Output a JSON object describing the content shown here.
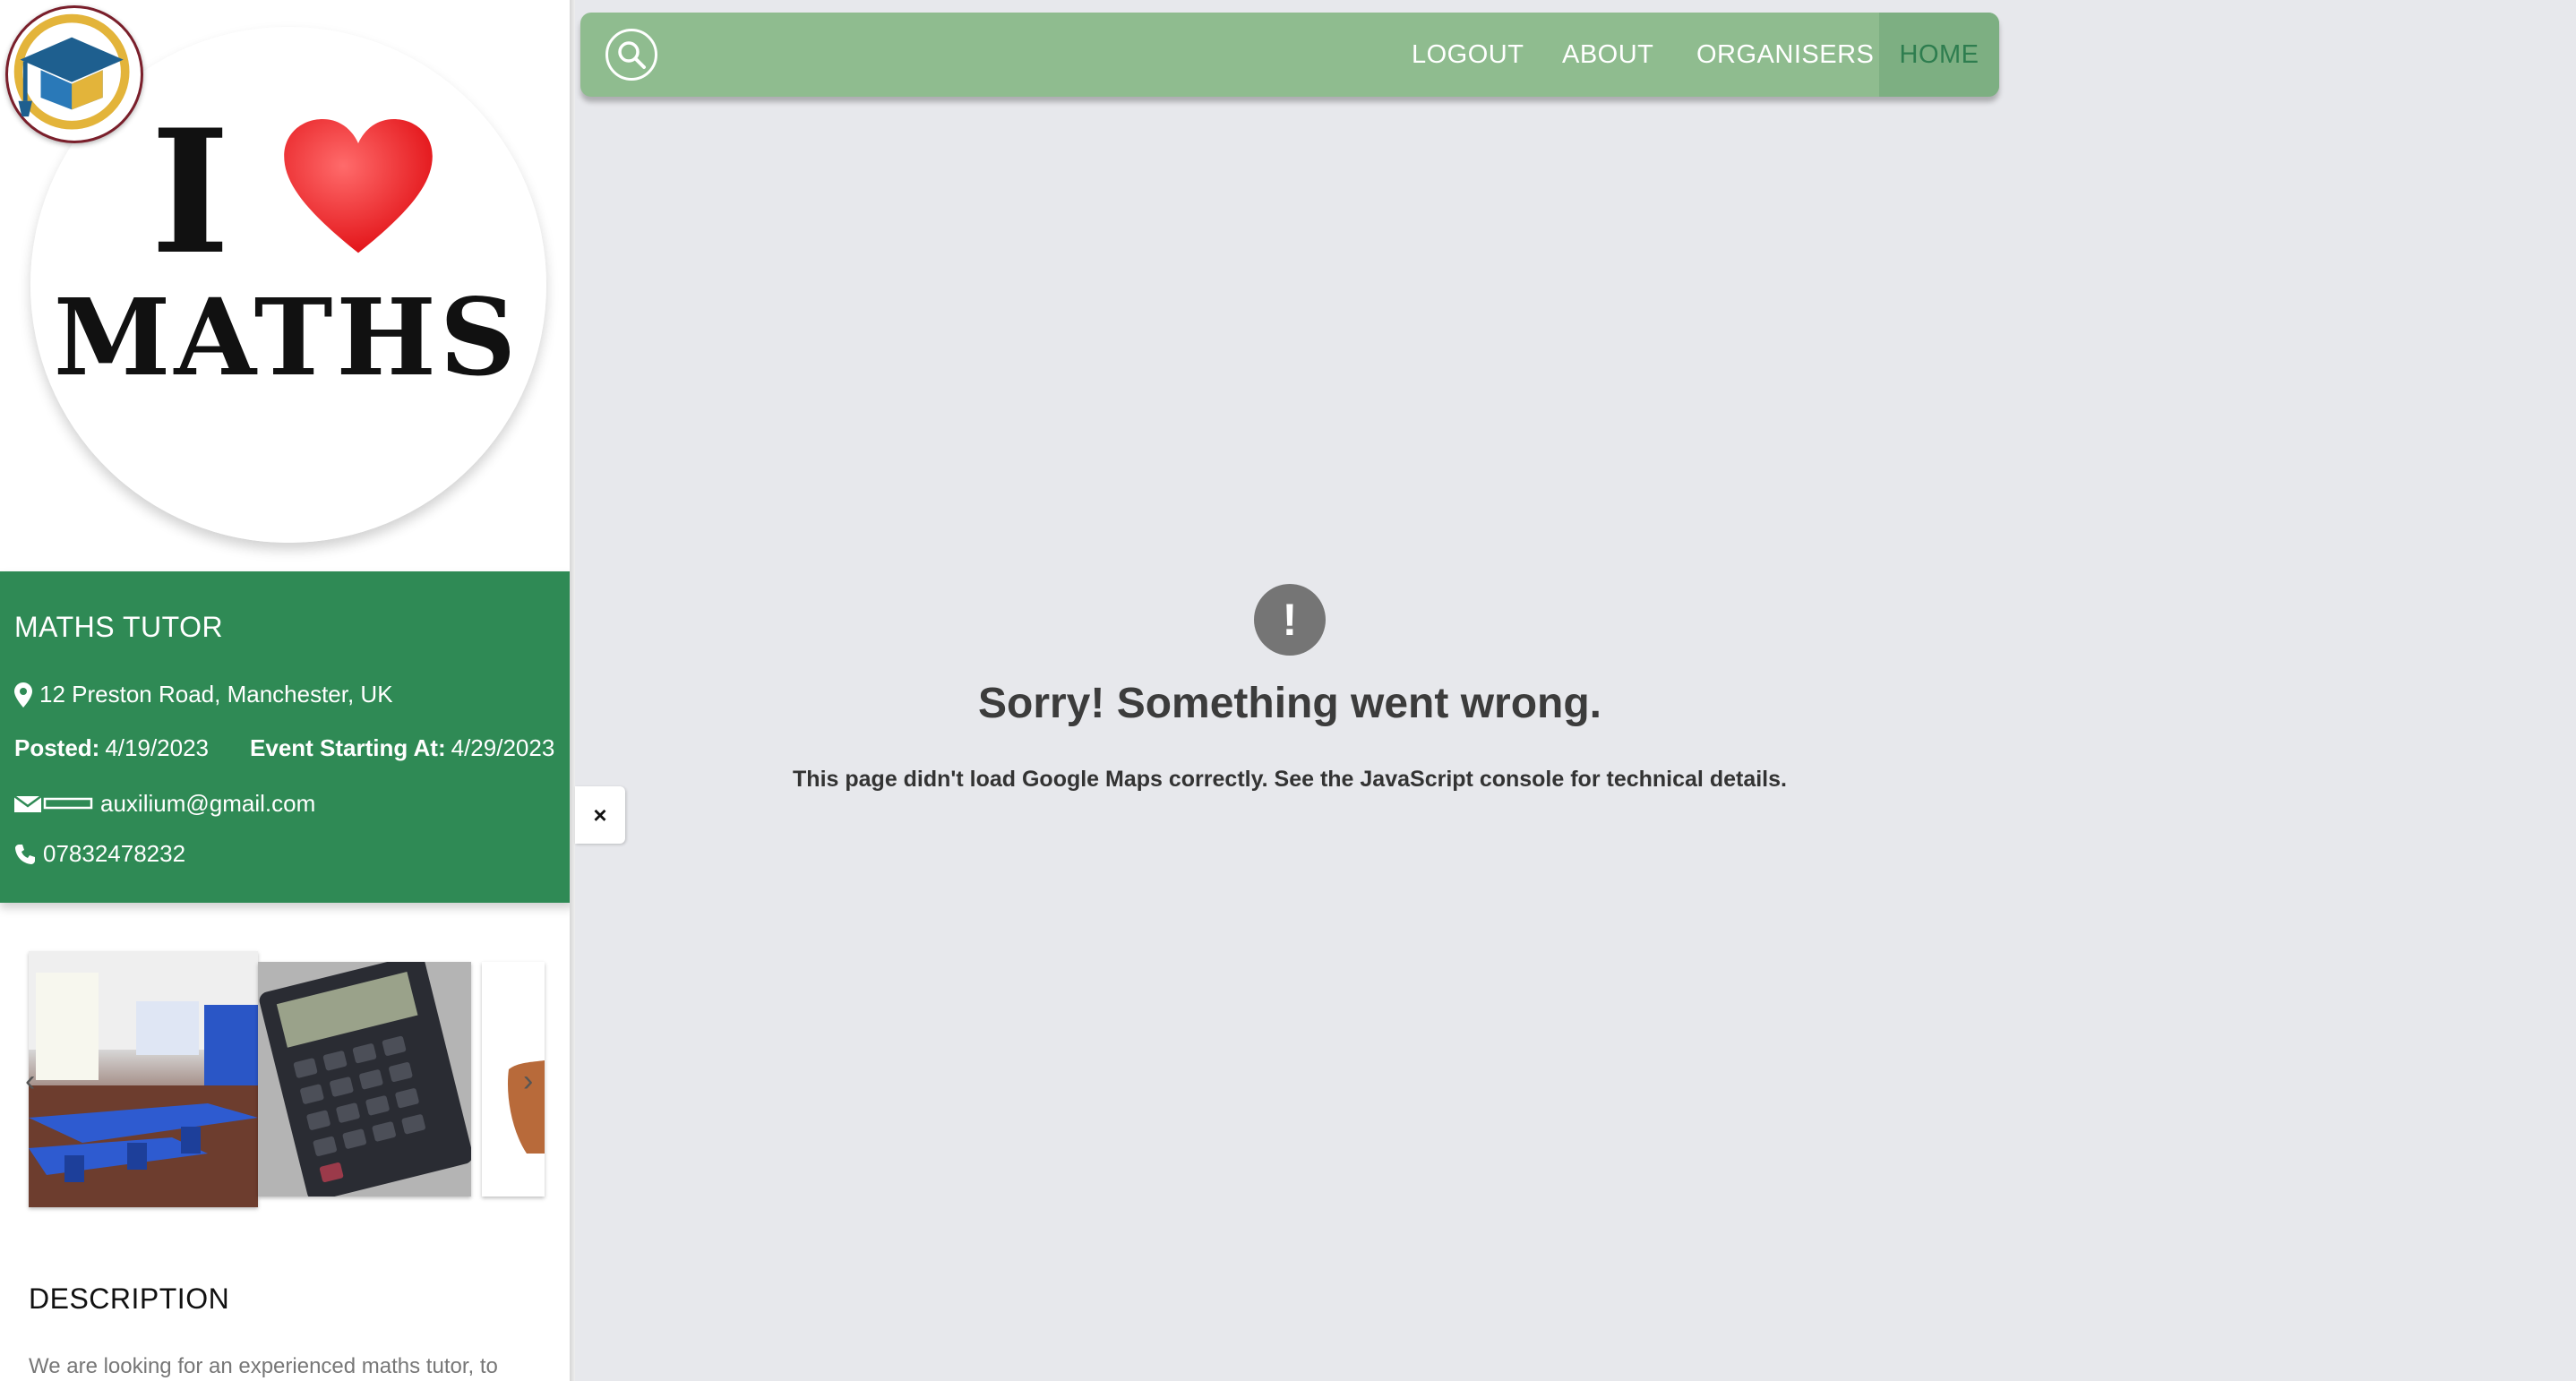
{
  "nav": {
    "search_icon": "search-icon",
    "items": [
      {
        "label": "LOGOUT"
      },
      {
        "label": "ABOUT"
      },
      {
        "label": "ORGANISERS"
      },
      {
        "label": "HOME",
        "active": true
      }
    ],
    "color": "#8fbc8f"
  },
  "hero": {
    "badge_letter": "I",
    "badge_word": "MATHS"
  },
  "event": {
    "title": "MATHS TUTOR",
    "address": "12 Preston Road, Manchester, UK",
    "posted_label": "Posted:",
    "posted_value": "4/19/2023",
    "start_label": "Event Starting At:",
    "start_value": "4/29/2023",
    "email": "auxilium@gmail.com",
    "phone": "07832478232",
    "card_color": "#2f8a55"
  },
  "carousel": {
    "prev_icon": "chevron-left-icon",
    "next_icon": "chevron-right-icon"
  },
  "description": {
    "heading": "DESCRIPTION",
    "text": "We are looking for an experienced maths tutor, to"
  },
  "close_tab": {
    "label": "×"
  },
  "map_error": {
    "icon": "!",
    "title": "Sorry! Something went wrong.",
    "detail": "This page didn't load Google Maps correctly. See the JavaScript console for technical details."
  }
}
